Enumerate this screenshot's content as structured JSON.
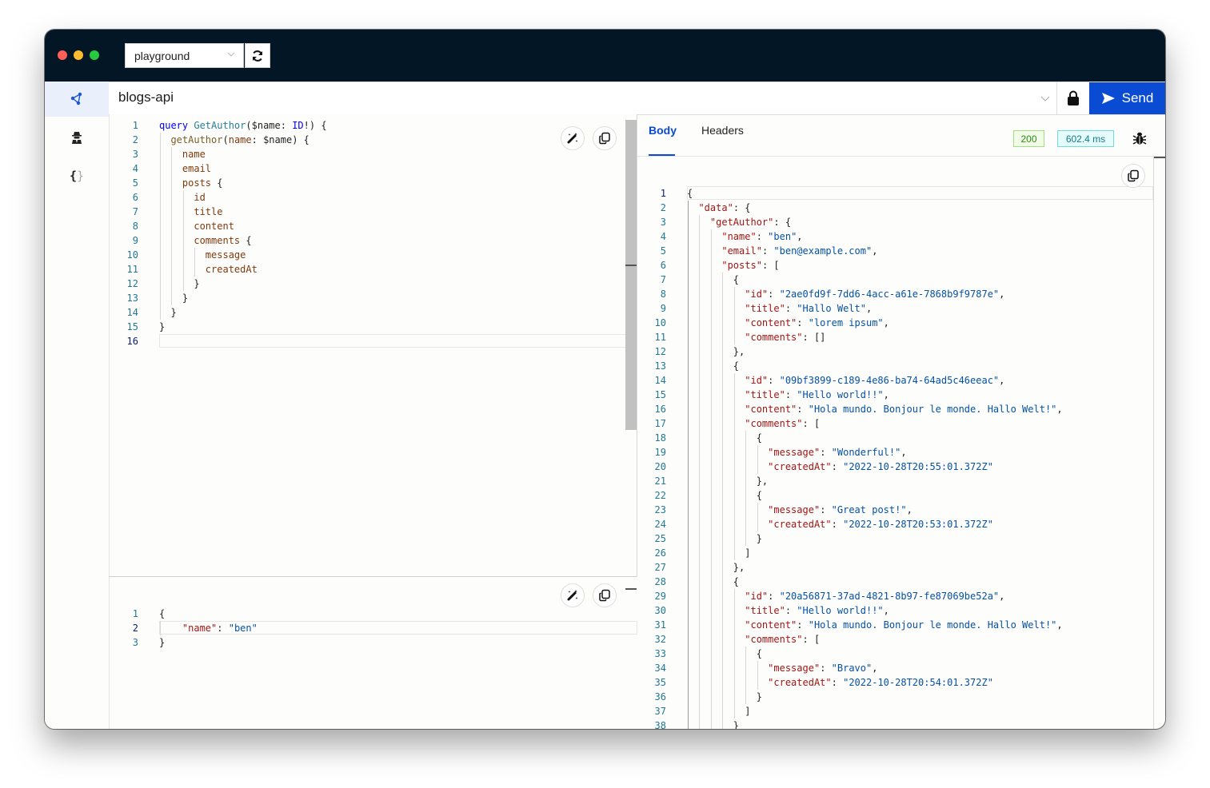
{
  "titlebar": {
    "environment": "playground",
    "refresh_icon": "refresh-icon"
  },
  "sidebar": {
    "items": [
      {
        "name": "graphql-icon",
        "active": true
      },
      {
        "name": "spy-icon",
        "active": false
      },
      {
        "name": "braces-icon",
        "active": false
      }
    ]
  },
  "urlbar": {
    "value": "blogs-api",
    "lock_icon": "lock-icon",
    "send_label": "Send"
  },
  "query_editor": {
    "current_line": 16,
    "lines": [
      [
        [
          "kw",
          "query"
        ],
        [
          "pl",
          " "
        ],
        [
          "ty",
          "GetAuthor"
        ],
        [
          "pl",
          "("
        ],
        [
          "var",
          "$name"
        ],
        [
          "pl",
          ": "
        ],
        [
          "kw",
          "ID"
        ],
        [
          "pl",
          "!) {"
        ]
      ],
      [
        [
          "pl",
          "  "
        ],
        [
          "fn",
          "getAuthor"
        ],
        [
          "pl",
          "("
        ],
        [
          "fld",
          "name"
        ],
        [
          "pl",
          ": "
        ],
        [
          "var",
          "$name"
        ],
        [
          "pl",
          ") {"
        ]
      ],
      [
        [
          "pl",
          "    "
        ],
        [
          "fld",
          "name"
        ]
      ],
      [
        [
          "pl",
          "    "
        ],
        [
          "fld",
          "email"
        ]
      ],
      [
        [
          "pl",
          "    "
        ],
        [
          "fld",
          "posts"
        ],
        [
          "pl",
          " {"
        ]
      ],
      [
        [
          "pl",
          "      "
        ],
        [
          "fld",
          "id"
        ]
      ],
      [
        [
          "pl",
          "      "
        ],
        [
          "fld",
          "title"
        ]
      ],
      [
        [
          "pl",
          "      "
        ],
        [
          "fld",
          "content"
        ]
      ],
      [
        [
          "pl",
          "      "
        ],
        [
          "fld",
          "comments"
        ],
        [
          "pl",
          " {"
        ]
      ],
      [
        [
          "pl",
          "        "
        ],
        [
          "fld",
          "message"
        ]
      ],
      [
        [
          "pl",
          "        "
        ],
        [
          "fld",
          "createdAt"
        ]
      ],
      [
        [
          "pl",
          "      }"
        ]
      ],
      [
        [
          "pl",
          "    }"
        ]
      ],
      [
        [
          "pl",
          "  }"
        ]
      ],
      [
        [
          "pl",
          "}"
        ]
      ],
      [
        [
          "pl",
          ""
        ]
      ]
    ]
  },
  "variables_editor": {
    "current_line": 2,
    "lines": [
      [
        [
          "pl",
          "{"
        ]
      ],
      [
        [
          "pl",
          "    "
        ],
        [
          "key",
          "\"name\""
        ],
        [
          "pl",
          ": "
        ],
        [
          "str",
          "\"ben\""
        ]
      ],
      [
        [
          "pl",
          "}"
        ]
      ]
    ]
  },
  "response": {
    "tabs": [
      "Body",
      "Headers"
    ],
    "active_tab": "Body",
    "status": "200",
    "time": "602.4 ms",
    "debug_icon": "bug-icon",
    "current_line": 1,
    "lines": [
      [
        [
          "pl",
          "{"
        ]
      ],
      [
        [
          "pl",
          "  "
        ],
        [
          "key",
          "\"data\""
        ],
        [
          "pl",
          ": {"
        ]
      ],
      [
        [
          "pl",
          "    "
        ],
        [
          "key",
          "\"getAuthor\""
        ],
        [
          "pl",
          ": {"
        ]
      ],
      [
        [
          "pl",
          "      "
        ],
        [
          "key",
          "\"name\""
        ],
        [
          "pl",
          ": "
        ],
        [
          "str",
          "\"ben\""
        ],
        [
          "pl",
          ","
        ]
      ],
      [
        [
          "pl",
          "      "
        ],
        [
          "key",
          "\"email\""
        ],
        [
          "pl",
          ": "
        ],
        [
          "str",
          "\"ben@example.com\""
        ],
        [
          "pl",
          ","
        ]
      ],
      [
        [
          "pl",
          "      "
        ],
        [
          "key",
          "\"posts\""
        ],
        [
          "pl",
          ": ["
        ]
      ],
      [
        [
          "pl",
          "        {"
        ]
      ],
      [
        [
          "pl",
          "          "
        ],
        [
          "key",
          "\"id\""
        ],
        [
          "pl",
          ": "
        ],
        [
          "str",
          "\"2ae0fd9f-7dd6-4acc-a61e-7868b9f9787e\""
        ],
        [
          "pl",
          ","
        ]
      ],
      [
        [
          "pl",
          "          "
        ],
        [
          "key",
          "\"title\""
        ],
        [
          "pl",
          ": "
        ],
        [
          "str",
          "\"Hallo Welt\""
        ],
        [
          "pl",
          ","
        ]
      ],
      [
        [
          "pl",
          "          "
        ],
        [
          "key",
          "\"content\""
        ],
        [
          "pl",
          ": "
        ],
        [
          "str",
          "\"lorem ipsum\""
        ],
        [
          "pl",
          ","
        ]
      ],
      [
        [
          "pl",
          "          "
        ],
        [
          "key",
          "\"comments\""
        ],
        [
          "pl",
          ": []"
        ]
      ],
      [
        [
          "pl",
          "        },"
        ]
      ],
      [
        [
          "pl",
          "        {"
        ]
      ],
      [
        [
          "pl",
          "          "
        ],
        [
          "key",
          "\"id\""
        ],
        [
          "pl",
          ": "
        ],
        [
          "str",
          "\"09bf3899-c189-4e86-ba74-64ad5c46eeac\""
        ],
        [
          "pl",
          ","
        ]
      ],
      [
        [
          "pl",
          "          "
        ],
        [
          "key",
          "\"title\""
        ],
        [
          "pl",
          ": "
        ],
        [
          "str",
          "\"Hello world!!\""
        ],
        [
          "pl",
          ","
        ]
      ],
      [
        [
          "pl",
          "          "
        ],
        [
          "key",
          "\"content\""
        ],
        [
          "pl",
          ": "
        ],
        [
          "str",
          "\"Hola mundo. Bonjour le monde. Hallo Welt!\""
        ],
        [
          "pl",
          ","
        ]
      ],
      [
        [
          "pl",
          "          "
        ],
        [
          "key",
          "\"comments\""
        ],
        [
          "pl",
          ": ["
        ]
      ],
      [
        [
          "pl",
          "            {"
        ]
      ],
      [
        [
          "pl",
          "              "
        ],
        [
          "key",
          "\"message\""
        ],
        [
          "pl",
          ": "
        ],
        [
          "str",
          "\"Wonderful!\""
        ],
        [
          "pl",
          ","
        ]
      ],
      [
        [
          "pl",
          "              "
        ],
        [
          "key",
          "\"createdAt\""
        ],
        [
          "pl",
          ": "
        ],
        [
          "str",
          "\"2022-10-28T20:55:01.372Z\""
        ]
      ],
      [
        [
          "pl",
          "            },"
        ]
      ],
      [
        [
          "pl",
          "            {"
        ]
      ],
      [
        [
          "pl",
          "              "
        ],
        [
          "key",
          "\"message\""
        ],
        [
          "pl",
          ": "
        ],
        [
          "str",
          "\"Great post!\""
        ],
        [
          "pl",
          ","
        ]
      ],
      [
        [
          "pl",
          "              "
        ],
        [
          "key",
          "\"createdAt\""
        ],
        [
          "pl",
          ": "
        ],
        [
          "str",
          "\"2022-10-28T20:53:01.372Z\""
        ]
      ],
      [
        [
          "pl",
          "            }"
        ]
      ],
      [
        [
          "pl",
          "          ]"
        ]
      ],
      [
        [
          "pl",
          "        },"
        ]
      ],
      [
        [
          "pl",
          "        {"
        ]
      ],
      [
        [
          "pl",
          "          "
        ],
        [
          "key",
          "\"id\""
        ],
        [
          "pl",
          ": "
        ],
        [
          "str",
          "\"20a56871-37ad-4821-8b97-fe87069be52a\""
        ],
        [
          "pl",
          ","
        ]
      ],
      [
        [
          "pl",
          "          "
        ],
        [
          "key",
          "\"title\""
        ],
        [
          "pl",
          ": "
        ],
        [
          "str",
          "\"Hello world!!\""
        ],
        [
          "pl",
          ","
        ]
      ],
      [
        [
          "pl",
          "          "
        ],
        [
          "key",
          "\"content\""
        ],
        [
          "pl",
          ": "
        ],
        [
          "str",
          "\"Hola mundo. Bonjour le monde. Hallo Welt!\""
        ],
        [
          "pl",
          ","
        ]
      ],
      [
        [
          "pl",
          "          "
        ],
        [
          "key",
          "\"comments\""
        ],
        [
          "pl",
          ": ["
        ]
      ],
      [
        [
          "pl",
          "            {"
        ]
      ],
      [
        [
          "pl",
          "              "
        ],
        [
          "key",
          "\"message\""
        ],
        [
          "pl",
          ": "
        ],
        [
          "str",
          "\"Bravo\""
        ],
        [
          "pl",
          ","
        ]
      ],
      [
        [
          "pl",
          "              "
        ],
        [
          "key",
          "\"createdAt\""
        ],
        [
          "pl",
          ": "
        ],
        [
          "str",
          "\"2022-10-28T20:54:01.372Z\""
        ]
      ],
      [
        [
          "pl",
          "            }"
        ]
      ],
      [
        [
          "pl",
          "          ]"
        ]
      ],
      [
        [
          "pl",
          "        }"
        ]
      ],
      [
        [
          "pl",
          "      ]"
        ]
      ],
      [
        [
          "pl",
          "    }"
        ]
      ]
    ]
  },
  "editor_buttons": {
    "prettify_icon": "magic-wand-icon",
    "copy_icon": "copy-icon"
  }
}
